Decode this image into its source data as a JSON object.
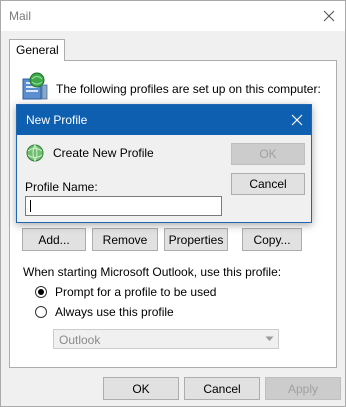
{
  "mail": {
    "title": "Mail",
    "tab_label": "General",
    "profiles_heading": "The following profiles are set up on this computer:",
    "buttons": {
      "add": "Add...",
      "remove": "Remove",
      "properties": "Properties",
      "copy": "Copy..."
    },
    "startup_label": "When starting Microsoft Outlook, use this profile:",
    "radio_prompt": "Prompt for a profile to be used",
    "radio_always": "Always use this profile",
    "selected_profile": "Outlook",
    "footer": {
      "ok": "OK",
      "cancel": "Cancel",
      "apply": "Apply"
    }
  },
  "new_profile": {
    "title": "New Profile",
    "heading": "Create New Profile",
    "name_label": "Profile Name:",
    "name_value": "",
    "ok": "OK",
    "cancel": "Cancel"
  },
  "icons": {
    "close": "close-icon",
    "profiles": "profiles-icon",
    "globe": "globe-icon",
    "dropdown": "chevron-down-icon"
  },
  "colors": {
    "accent": "#0f5fb0",
    "window_bg": "#f0f0f0",
    "button_bg": "#e1e1e1"
  }
}
